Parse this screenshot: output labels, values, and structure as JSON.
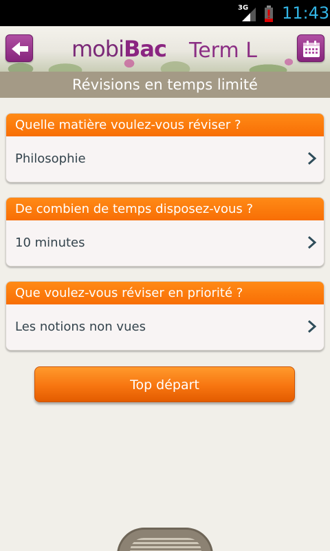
{
  "status_bar": {
    "network": "3G",
    "time": "11:43"
  },
  "header": {
    "logo_part1": "mobi",
    "logo_part2": "Bac",
    "level": "Term L",
    "back_icon": "arrow-left-icon",
    "calendar_icon": "calendar-icon"
  },
  "title": "Révisions en temps limité",
  "cards": [
    {
      "question": "Quelle matière voulez-vous réviser ?",
      "answer": "Philosophie"
    },
    {
      "question": "De combien de temps disposez-vous ?",
      "answer": "10 minutes"
    },
    {
      "question": "Que voulez-vous réviser en priorité ?",
      "answer": "Les notions non vues"
    }
  ],
  "start_button": "Top départ",
  "colors": {
    "accent_orange": "#f86e05",
    "brand_purple": "#8a2581",
    "title_bar": "#a49a86",
    "status_clock": "#33b5e5"
  }
}
